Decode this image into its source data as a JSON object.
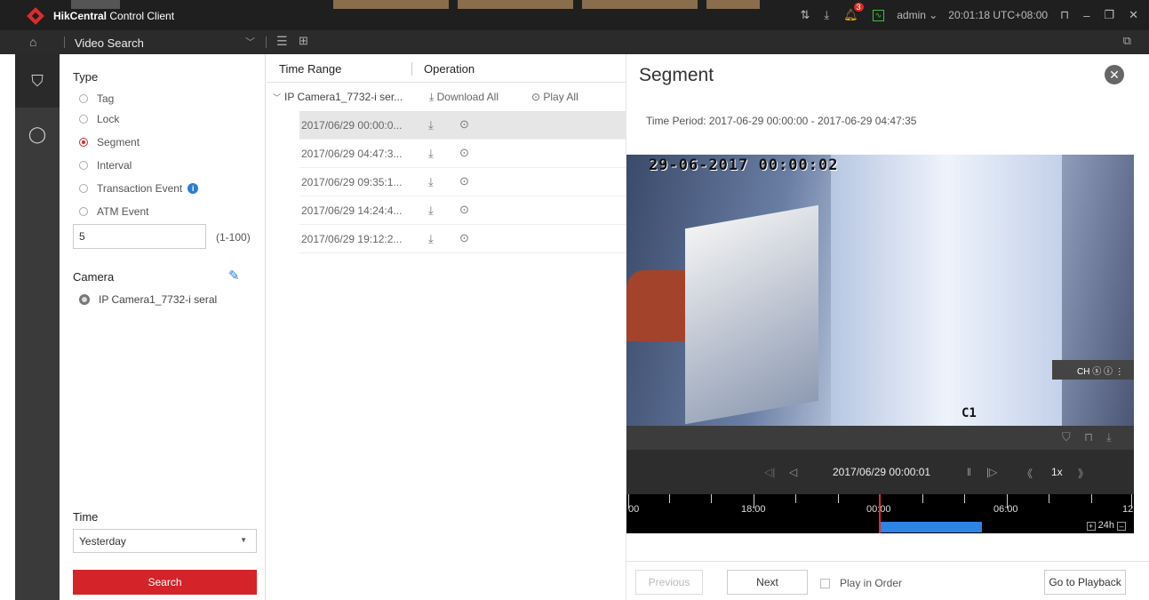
{
  "app": {
    "name_bold": "HikCentral",
    "name_rest": " Control Client",
    "user": "admin",
    "clock": "20:01:18 UTC+08:00",
    "alarm_count": "3"
  },
  "nav": {
    "title": "Video Search"
  },
  "search": {
    "type_label": "Type",
    "types": [
      {
        "label": "Tag",
        "checked": false
      },
      {
        "label": "Lock",
        "checked": false
      },
      {
        "label": "Segment",
        "checked": true
      },
      {
        "label": "Interval",
        "checked": false
      },
      {
        "label": "Transaction Event",
        "checked": false
      },
      {
        "label": "ATM Event",
        "checked": false
      }
    ],
    "interval_value": "5",
    "interval_range": "(1-100)",
    "camera_label": "Camera",
    "camera_name": "IP Camera1_7732-i seral",
    "time_label": "Time",
    "time_value": "Yesterday",
    "search_button": "Search"
  },
  "results": {
    "col_time_range": "Time Range",
    "col_operation": "Operation",
    "group_name": "IP Camera1_7732-i ser...",
    "download_all": "Download All",
    "play_all": "Play All",
    "segments": [
      "2017/06/29 00:00:0...",
      "2017/06/29 04:47:3...",
      "2017/06/29 09:35:1...",
      "2017/06/29 14:24:4...",
      "2017/06/29 19:12:2..."
    ]
  },
  "detail": {
    "title": "Segment",
    "time_period_label": "Time Period:",
    "time_period_value": "2017-06-29 00:00:00 - 2017-06-29 04:47:35",
    "osd_timestamp": "29-06-2017 00:00:02",
    "osd_channel": "C1",
    "playback_time": "2017/06/29 00:00:01",
    "speed": "1x",
    "timeline_labels": [
      "00",
      "18:00",
      "00:00",
      "06:00",
      "12"
    ],
    "timeline_zoom": "24h",
    "previous_button": "Previous",
    "next_button": "Next",
    "play_in_order": "Play in Order",
    "go_to_playback": "Go to Playback"
  }
}
